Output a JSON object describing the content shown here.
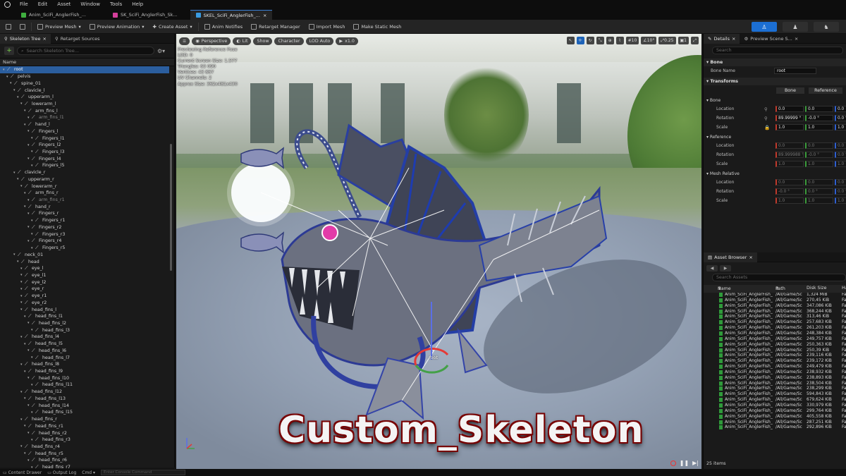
{
  "menu": [
    "File",
    "Edit",
    "Asset",
    "Window",
    "Tools",
    "Help"
  ],
  "doc_tabs": [
    {
      "label": "Anim_SciFi_AnglerFish_...",
      "active": false,
      "color": "#3fae3f"
    },
    {
      "label": "SK_SciFi_AnglerFish_Sk...",
      "active": false,
      "color": "#d43f9b"
    },
    {
      "label": "SKEL_SciFi_AnglerFish_...",
      "active": true,
      "color": "#3a9be0"
    }
  ],
  "doc_tab_close": "×",
  "toolbar": {
    "preview_mesh": "Preview Mesh",
    "preview_animation": "Preview Animation",
    "create_asset": "Create Asset",
    "anim_notifies": "Anim Notifies",
    "retarget_manager": "Retarget Manager",
    "import_mesh": "Import Mesh",
    "make_static_mesh": "Make Static Mesh"
  },
  "skeleton_panel": {
    "tabs": [
      "Skeleton Tree",
      "Retarget Sources"
    ],
    "search_placeholder": "Search Skeleton Tree...",
    "column_name": "Name",
    "bones": [
      {
        "name": "root",
        "depth": 0,
        "selected": true
      },
      {
        "name": "pelvis",
        "depth": 1
      },
      {
        "name": "spine_01",
        "depth": 2
      },
      {
        "name": "clavicle_l",
        "depth": 3
      },
      {
        "name": "upperarm_l",
        "depth": 4
      },
      {
        "name": "lowerarm_l",
        "depth": 5
      },
      {
        "name": "arm_fins_l",
        "depth": 6
      },
      {
        "name": "arm_fins_l1",
        "depth": 7,
        "dim": true
      },
      {
        "name": "hand_l",
        "depth": 6
      },
      {
        "name": "Fingers_l",
        "depth": 7
      },
      {
        "name": "Fingers_l1",
        "depth": 8
      },
      {
        "name": "Fingers_l2",
        "depth": 7
      },
      {
        "name": "Fingers_l3",
        "depth": 8
      },
      {
        "name": "Fingers_l4",
        "depth": 7
      },
      {
        "name": "Fingers_l5",
        "depth": 8
      },
      {
        "name": "clavicle_r",
        "depth": 3
      },
      {
        "name": "upperarm_r",
        "depth": 4
      },
      {
        "name": "lowerarm_r",
        "depth": 5
      },
      {
        "name": "arm_fins_r",
        "depth": 6
      },
      {
        "name": "arm_fins_r1",
        "depth": 7,
        "dim": true
      },
      {
        "name": "hand_r",
        "depth": 6
      },
      {
        "name": "Fingers_r",
        "depth": 7
      },
      {
        "name": "Fingers_r1",
        "depth": 8
      },
      {
        "name": "Fingers_r2",
        "depth": 7
      },
      {
        "name": "Fingers_r3",
        "depth": 8
      },
      {
        "name": "Fingers_r4",
        "depth": 7
      },
      {
        "name": "Fingers_r5",
        "depth": 8
      },
      {
        "name": "neck_01",
        "depth": 3
      },
      {
        "name": "head",
        "depth": 4
      },
      {
        "name": "eye_l",
        "depth": 5
      },
      {
        "name": "eye_l1",
        "depth": 5
      },
      {
        "name": "eye_l2",
        "depth": 5
      },
      {
        "name": "eye_r",
        "depth": 5
      },
      {
        "name": "eye_r1",
        "depth": 5
      },
      {
        "name": "eye_r2",
        "depth": 5
      },
      {
        "name": "head_fins_l",
        "depth": 5
      },
      {
        "name": "head_fins_l1",
        "depth": 6
      },
      {
        "name": "head_fins_l2",
        "depth": 7
      },
      {
        "name": "head_fins_l3",
        "depth": 8
      },
      {
        "name": "head_fins_l4",
        "depth": 5
      },
      {
        "name": "head_fins_l5",
        "depth": 6
      },
      {
        "name": "head_fins_l6",
        "depth": 7
      },
      {
        "name": "head_fins_l7",
        "depth": 8
      },
      {
        "name": "head_fins_l8",
        "depth": 5
      },
      {
        "name": "head_fins_l9",
        "depth": 6
      },
      {
        "name": "head_fins_l10",
        "depth": 7
      },
      {
        "name": "head_fins_l11",
        "depth": 8
      },
      {
        "name": "head_fins_l12",
        "depth": 5
      },
      {
        "name": "head_fins_l13",
        "depth": 6
      },
      {
        "name": "head_fins_l14",
        "depth": 7
      },
      {
        "name": "head_fins_l15",
        "depth": 8
      },
      {
        "name": "head_fins_r",
        "depth": 5
      },
      {
        "name": "head_fins_r1",
        "depth": 6
      },
      {
        "name": "head_fins_r2",
        "depth": 7
      },
      {
        "name": "head_fins_r3",
        "depth": 8
      },
      {
        "name": "head_fins_r4",
        "depth": 5
      },
      {
        "name": "head_fins_r5",
        "depth": 6
      },
      {
        "name": "head_fins_r6",
        "depth": 7
      },
      {
        "name": "head_fins_r7",
        "depth": 8
      }
    ]
  },
  "viewport": {
    "perspective": "Perspective",
    "lit": "Lit",
    "show": "Show",
    "character": "Character",
    "lod": "LOD Auto",
    "speed": "x1.0",
    "grid_snap": "10",
    "rot_snap": "10°",
    "scale_snap": "0.25",
    "camera_speed": "1",
    "stats": [
      "Previewing Reference Pose",
      "LOD: 0",
      "Current Screen Size: 1.577",
      "Triangles: 63 090",
      "Vertices: 43 867",
      "UV Channels: 2",
      "Approx Size: 362x481x430"
    ],
    "root_label": "root",
    "overlay_title": "Custom_Skeleton"
  },
  "details": {
    "tabs": [
      "Details",
      "Preview Scene S..."
    ],
    "search_placeholder": "Search",
    "bone_section": "Bone",
    "bone_name_label": "Bone Name",
    "bone_name_value": "root",
    "transforms_section": "Transforms",
    "seg_bone": "Bone",
    "seg_reference": "Reference",
    "bone_sub": "Bone",
    "reference_sub": "Reference",
    "mesh_relative_sub": "Mesh Relative",
    "location": "Location",
    "rotation": "Rotation",
    "scale": "Scale",
    "bone_vals": {
      "location": [
        "0.0",
        "0.0",
        "0.0"
      ],
      "rotation": [
        "89.99999 °",
        "-0.0 °",
        "0.0 °"
      ],
      "scale": [
        "1.0",
        "1.0",
        "1.0"
      ]
    },
    "ref_vals": {
      "location": [
        "0.0",
        "0.0",
        "0.0"
      ],
      "rotation": [
        "89.999988 °",
        "-0.0 °",
        "0.0 °"
      ],
      "scale": [
        "1.0",
        "1.0",
        "1.0"
      ]
    },
    "mesh_vals": {
      "location": [
        "0.0",
        "0.0",
        "0.0"
      ],
      "rotation": [
        "-0.0 °",
        "0.0 °",
        "0.0 °"
      ],
      "scale": [
        "1.0",
        "1.0",
        "1.0"
      ]
    }
  },
  "asset_browser": {
    "tab": "Asset Browser",
    "search_placeholder": "Search Assets",
    "col_name": "Name",
    "col_path": "Path",
    "col_disk": "Disk Size",
    "col_extra": "Ha",
    "items": [
      {
        "name": "Anim_SciFi_AnglerFish_",
        "path": "/All/Game/Sc",
        "size": "1,324 MiB",
        "extra": "Fa"
      },
      {
        "name": "Anim_SciFi_AnglerFish_",
        "path": "/All/Game/Sc",
        "size": "270,45 KiB",
        "extra": "Fa"
      },
      {
        "name": "Anim_SciFi_AnglerFish_",
        "path": "/All/Game/Sc",
        "size": "347,086 KiB",
        "extra": "Fa"
      },
      {
        "name": "Anim_SciFi_AnglerFish_",
        "path": "/All/Game/Sc",
        "size": "368,244 KiB",
        "extra": "Fa"
      },
      {
        "name": "Anim_SciFi_AnglerFish_",
        "path": "/All/Game/Sc",
        "size": "313,46 KiB",
        "extra": "Fa"
      },
      {
        "name": "Anim_SciFi_AnglerFish_",
        "path": "/All/Game/Sc",
        "size": "257,683 KiB",
        "extra": "Fa"
      },
      {
        "name": "Anim_SciFi_AnglerFish_",
        "path": "/All/Game/Sc",
        "size": "261,203 KiB",
        "extra": "Fa"
      },
      {
        "name": "Anim_SciFi_AnglerFish_",
        "path": "/All/Game/Sc",
        "size": "248,384 KiB",
        "extra": "Fa"
      },
      {
        "name": "Anim_SciFi_AnglerFish_",
        "path": "/All/Game/Sc",
        "size": "249,757 KiB",
        "extra": "Fa"
      },
      {
        "name": "Anim_SciFi_AnglerFish_",
        "path": "/All/Game/Sc",
        "size": "250,363 KiB",
        "extra": "Fa"
      },
      {
        "name": "Anim_SciFi_AnglerFish_",
        "path": "/All/Game/Sc",
        "size": "250,39 KiB",
        "extra": "Fa"
      },
      {
        "name": "Anim_SciFi_AnglerFish_",
        "path": "/All/Game/Sc",
        "size": "239,116 KiB",
        "extra": "Fa"
      },
      {
        "name": "Anim_SciFi_AnglerFish_",
        "path": "/All/Game/Sc",
        "size": "239,172 KiB",
        "extra": "Fa"
      },
      {
        "name": "Anim_SciFi_AnglerFish_",
        "path": "/All/Game/Sc",
        "size": "249,479 KiB",
        "extra": "Fa"
      },
      {
        "name": "Anim_SciFi_AnglerFish_",
        "path": "/All/Game/Sc",
        "size": "238,932 KiB",
        "extra": "Fa"
      },
      {
        "name": "Anim_SciFi_AnglerFish_",
        "path": "/All/Game/Sc",
        "size": "238,893 KiB",
        "extra": "Fa"
      },
      {
        "name": "Anim_SciFi_AnglerFish_",
        "path": "/All/Game/Sc",
        "size": "238,504 KiB",
        "extra": "Fa"
      },
      {
        "name": "Anim_SciFi_AnglerFish_",
        "path": "/All/Game/Sc",
        "size": "238,299 KiB",
        "extra": "Fa"
      },
      {
        "name": "Anim_SciFi_AnglerFish_",
        "path": "/All/Game/Sc",
        "size": "594,843 KiB",
        "extra": "Fa"
      },
      {
        "name": "Anim_SciFi_AnglerFish_",
        "path": "/All/Game/Sc",
        "size": "679,624 KiB",
        "extra": "Fa"
      },
      {
        "name": "Anim_SciFi_AnglerFish_",
        "path": "/All/Game/Sc",
        "size": "330,979 KiB",
        "extra": "Fa"
      },
      {
        "name": "Anim_SciFi_AnglerFish_",
        "path": "/All/Game/Sc",
        "size": "299,764 KiB",
        "extra": "Fa"
      },
      {
        "name": "Anim_SciFi_AnglerFish_",
        "path": "/All/Game/Sc",
        "size": "405,558 KiB",
        "extra": "Fa"
      },
      {
        "name": "Anim_SciFi_AnglerFish_",
        "path": "/All/Game/Sc",
        "size": "287,251 KiB",
        "extra": "Fa"
      },
      {
        "name": "Anim_SciFi_AnglerFish_",
        "path": "/All/Game/Sc",
        "size": "292,896 KiB",
        "extra": "Fa"
      }
    ],
    "count": "25 items"
  },
  "statusbar": {
    "content_drawer": "Content Drawer",
    "output_log": "Output Log",
    "cmd": "Cmd",
    "cmd_placeholder": "Enter Console Command"
  },
  "colors": {
    "accent": "#1c6fd3",
    "selection": "#2b5e9e",
    "title_outline": "#7a0000",
    "asset_icon": "#2f9a3a"
  }
}
